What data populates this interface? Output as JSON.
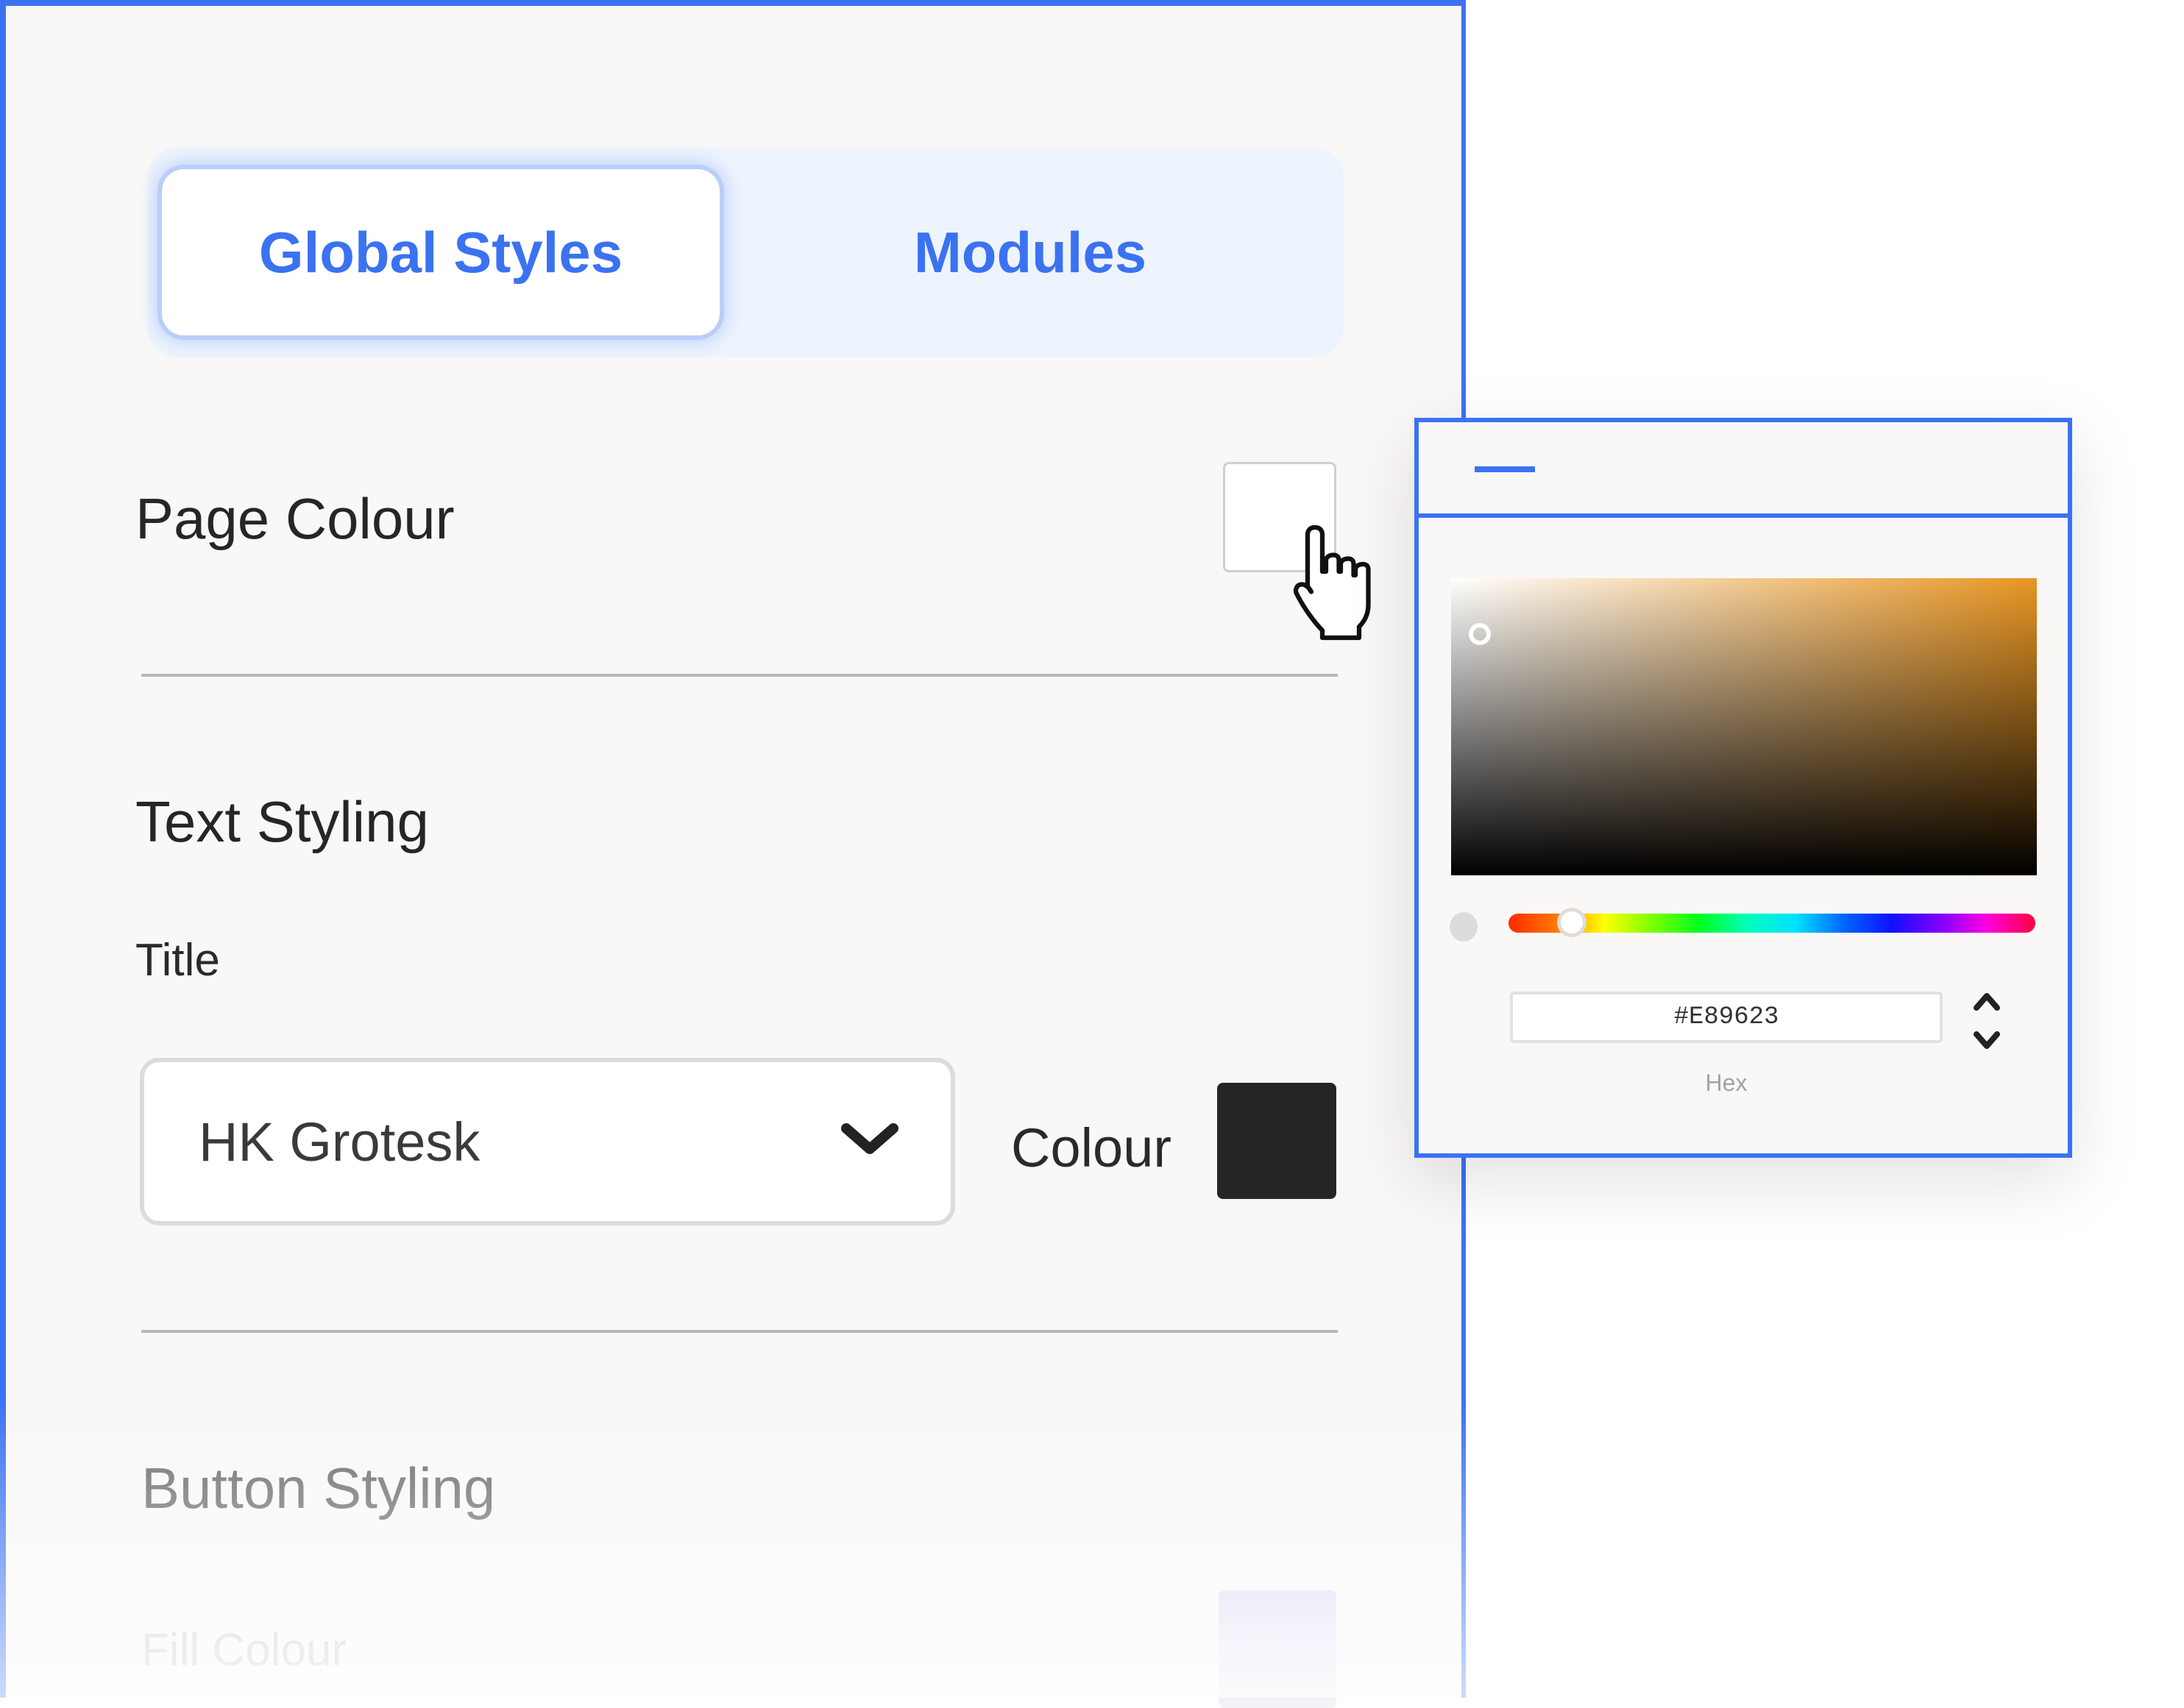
{
  "tabs": [
    {
      "label": "Global Styles",
      "active": true
    },
    {
      "label": "Modules",
      "active": false
    }
  ],
  "page_colour": {
    "label": "Page Colour",
    "value": "#FFFFFF"
  },
  "text_styling": {
    "heading": "Text Styling",
    "title_label": "Title",
    "font_select": {
      "value": "HK Grotesk"
    },
    "colour_label": "Colour",
    "colour_value": "#262524"
  },
  "button_styling": {
    "heading": "Button Styling",
    "fill_label": "Fill Colour",
    "fill_value": "#DCDCF6"
  },
  "color_picker": {
    "hex_value": "#E89623",
    "hex_label": "Hex",
    "hue_fraction": 0.12,
    "saturation_fraction": 0.03,
    "value_fraction": 0.85
  },
  "icons": {
    "minimize": "minus-icon",
    "cursor": "hand-pointer-icon",
    "dropdown": "chevron-down-icon",
    "stepper": "up-down-chevron-icon"
  },
  "colors": {
    "accent": "#3B72F1",
    "panel_bg": "#F9F8F7"
  }
}
